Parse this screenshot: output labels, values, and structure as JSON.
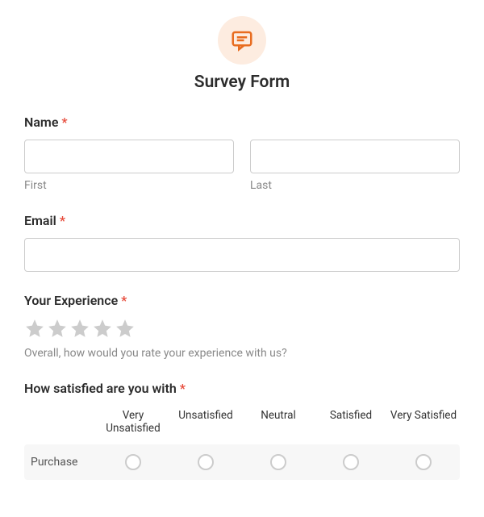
{
  "header": {
    "title": "Survey Form"
  },
  "name": {
    "label": "Name",
    "first_sublabel": "First",
    "last_sublabel": "Last"
  },
  "email": {
    "label": "Email"
  },
  "experience": {
    "label": "Your Experience",
    "hint": "Overall, how would you rate your experience with us?"
  },
  "satisfaction": {
    "label": "How satisfied are you with",
    "columns": [
      "Very Unsatisfied",
      "Unsatisfied",
      "Neutral",
      "Satisfied",
      "Very Satisfied"
    ],
    "rows": [
      "Purchase"
    ]
  },
  "required": "*"
}
